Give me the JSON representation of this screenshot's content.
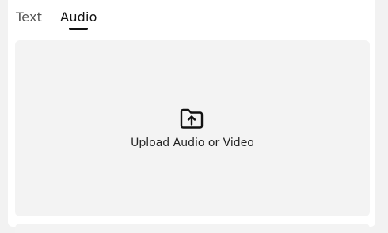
{
  "tabs": [
    {
      "label": "Text",
      "active": false
    },
    {
      "label": "Audio",
      "active": true
    }
  ],
  "dropzone": {
    "label": "Upload Audio or Video",
    "icon": "folder-upload-icon"
  },
  "colors": {
    "background": "#f2f2f2",
    "panel": "#ffffff",
    "dropzone": "#f3f3f3",
    "active_tab": "#111111",
    "inactive_tab": "#555555"
  }
}
